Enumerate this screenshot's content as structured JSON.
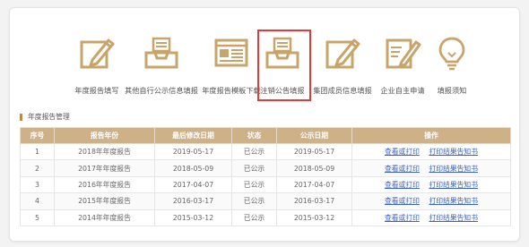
{
  "toolbar": {
    "items": [
      {
        "label": "年度报告填写",
        "icon": "pencil-edit-icon"
      },
      {
        "label": "其他自行公示信息填报",
        "icon": "inbox-tray-icon"
      },
      {
        "label": "年度报告模板下载",
        "icon": "template-download-icon"
      },
      {
        "label": "注销公告填报",
        "icon": "inbox-tray-icon",
        "selected": true
      },
      {
        "label": "集团成员信息填报",
        "icon": "pencil-edit-icon"
      },
      {
        "label": "企业自主申请",
        "icon": "document-pencil-icon"
      },
      {
        "label": "填报须知",
        "icon": "lightbulb-icon"
      }
    ]
  },
  "section": {
    "title": "年度报告管理"
  },
  "table": {
    "headers": [
      "序号",
      "报告年份",
      "最后修改日期",
      "状态",
      "公示日期",
      "操作"
    ],
    "rows": [
      {
        "no": "1",
        "year": "2018年年度报告",
        "modified": "2019-05-17",
        "status": "已公示",
        "published": "2019-05-17",
        "view": "查看或打印",
        "print": "打印结果告知书"
      },
      {
        "no": "2",
        "year": "2017年年度报告",
        "modified": "2018-05-09",
        "status": "已公示",
        "published": "2018-05-09",
        "view": "查看或打印",
        "print": "打印结果告知书"
      },
      {
        "no": "3",
        "year": "2016年年度报告",
        "modified": "2017-04-07",
        "status": "已公示",
        "published": "2017-04-07",
        "view": "查看或打印",
        "print": "打印结果告知书"
      },
      {
        "no": "4",
        "year": "2015年年度报告",
        "modified": "2016-03-17",
        "status": "已公示",
        "published": "2016-03-17",
        "view": "查看或打印",
        "print": "打印结果告知书"
      },
      {
        "no": "5",
        "year": "2014年年度报告",
        "modified": "2015-03-12",
        "status": "已公示",
        "published": "2015-03-12",
        "view": "查看或打印",
        "print": "打印结果告知书"
      }
    ]
  },
  "colors": {
    "accent": "#c9a46a",
    "header_bg": "#ceb187",
    "link": "#3b63c9",
    "selected_border": "#e53935"
  }
}
